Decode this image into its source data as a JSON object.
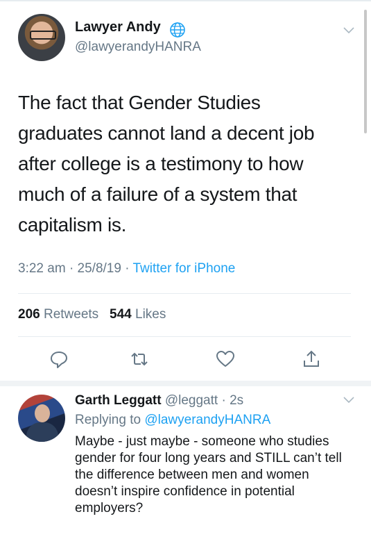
{
  "tweet": {
    "author_name": "Lawyer Andy",
    "author_handle": "@lawyerandyHANRA",
    "text": "The fact that Gender Studies graduates cannot land a decent job after college is a testimony to how much of a failure of a system that capitalism is.",
    "time": "3:22 am",
    "date": "25/8/19",
    "source": "Twitter for iPhone",
    "retweets_count": "206",
    "retweets_label": "Retweets",
    "likes_count": "544",
    "likes_label": "Likes"
  },
  "reply": {
    "author_name": "Garth Leggatt",
    "author_handle": "@leggatt",
    "time": "2s",
    "replying_to_label": "Replying to",
    "replying_to_handle": "@lawyerandyHANRA",
    "text": "Maybe - just maybe - someone who studies gender for four long years and STILL can’t tell the difference between men and women doesn’t inspire confidence in potential employers?"
  },
  "icons": {
    "verified_badge": "globe-icon",
    "reply": "reply-icon",
    "retweet": "retweet-icon",
    "like": "heart-icon",
    "share": "share-icon",
    "menu": "chevron-down-icon"
  },
  "colors": {
    "link": "#1da1f2",
    "secondary_text": "#657786",
    "primary_text": "#14171a"
  }
}
